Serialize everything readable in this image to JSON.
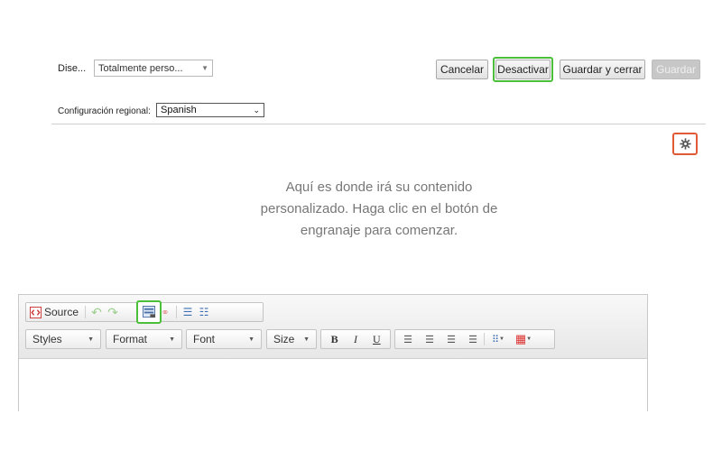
{
  "header": {
    "design_label": "Dise...",
    "design_select_value": "Totalmente perso...",
    "buttons": {
      "cancel": "Cancelar",
      "deactivate": "Desactivar",
      "save_close": "Guardar y cerrar",
      "save": "Guardar"
    },
    "locale_label": "Configuración regional:",
    "locale_value": "Spanish"
  },
  "content": {
    "placeholder_line1": "Aquí es donde irá su contenido",
    "placeholder_line2": "personalizado. Haga clic en el botón de",
    "placeholder_line3": "engranaje para comenzar."
  },
  "editor": {
    "source_label": "Source",
    "combos": {
      "styles": "Styles",
      "format": "Format",
      "font": "Font",
      "size": "Size"
    },
    "format_buttons": {
      "bold": "B",
      "italic": "I",
      "underline": "U"
    }
  },
  "colors": {
    "highlight_green": "#4cbf3a",
    "highlight_red": "#e05a36",
    "disabled_button": "#c7c7c7"
  },
  "icons": [
    "settings-gear-icon",
    "source-icon",
    "undo-icon",
    "redo-icon",
    "template-icon",
    "find-icon",
    "replace-icon",
    "numbered-list-icon",
    "bulleted-list-icon",
    "align-left-icon",
    "align-center-icon",
    "align-right-icon",
    "justify-icon",
    "text-color-icon",
    "table-icon"
  ]
}
